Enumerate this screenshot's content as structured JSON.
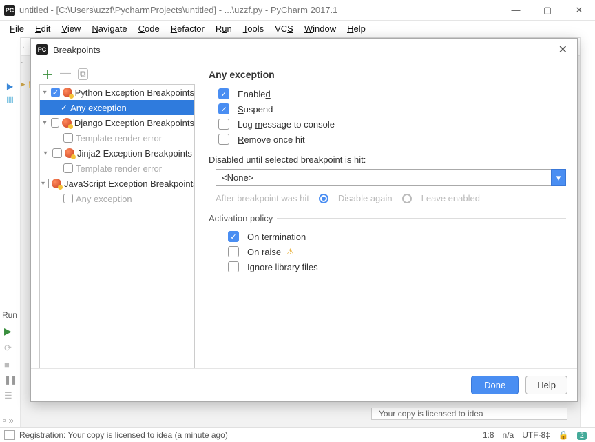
{
  "window": {
    "title": "untitled - [C:\\Users\\uzzf\\PycharmProjects\\untitled] - ...\\uzzf.py - PyCharm 2017.1"
  },
  "menu": [
    "File",
    "Edit",
    "View",
    "Navigate",
    "Code",
    "Refactor",
    "Run",
    "Tools",
    "VCS",
    "Window",
    "Help"
  ],
  "dialog": {
    "title": "Breakpoints",
    "tree": {
      "groups": [
        {
          "label": "Python Exception Breakpoints",
          "checked": true,
          "children": [
            {
              "label": "Any exception",
              "selected": true,
              "checked": true
            }
          ]
        },
        {
          "label": "Django Exception Breakpoints",
          "checked": false,
          "children": [
            {
              "label": "Template render error",
              "muted": true
            }
          ]
        },
        {
          "label": "Jinja2 Exception Breakpoints",
          "checked": false,
          "children": [
            {
              "label": "Template render error",
              "muted": true
            }
          ]
        },
        {
          "label": "JavaScript Exception Breakpoints",
          "checked": false,
          "children": [
            {
              "label": "Any exception",
              "muted": true
            }
          ]
        }
      ]
    },
    "detail": {
      "heading": "Any exception",
      "enabled_label": "Enabled",
      "suspend_label": "Suspend",
      "log_label": "Log message to console",
      "remove_label": "Remove once hit",
      "disabled_until_label": "Disabled until selected breakpoint is hit:",
      "combo_value": "<None>",
      "after_label": "After breakpoint was hit",
      "radio1": "Disable again",
      "radio2": "Leave enabled",
      "activation_section": "Activation policy",
      "on_termination": "On termination",
      "on_raise": "On raise",
      "ignore_lib": "Ignore library files"
    },
    "buttons": {
      "done": "Done",
      "help": "Help"
    }
  },
  "behind": {
    "run_label": "Run",
    "license_text": "Your copy is licensed to idea"
  },
  "status": {
    "msg": "Registration: Your copy is licensed to idea (a minute ago)",
    "pos": "1:8",
    "na": "n/a",
    "enc": "UTF-8",
    "badge": "2"
  }
}
